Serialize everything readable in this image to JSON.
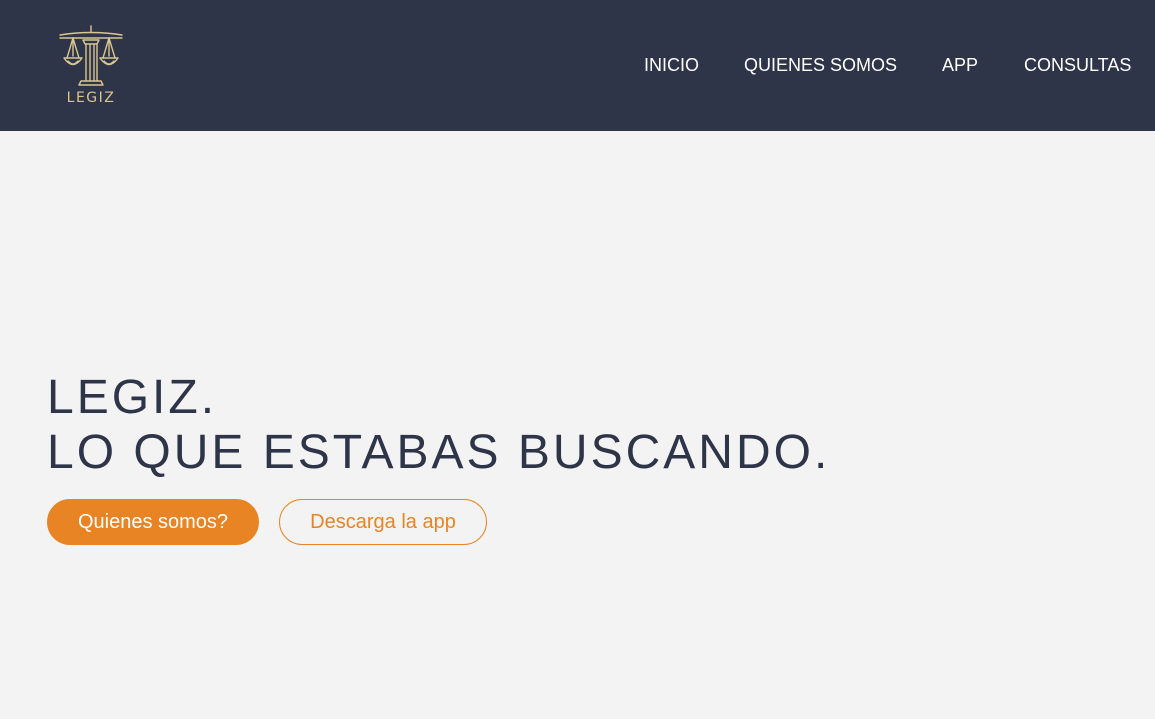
{
  "brand": {
    "logo_text": "LEGIZ",
    "logo_icon": "scales-of-justice-icon",
    "logo_color": "#d9c58f"
  },
  "nav": {
    "items": [
      {
        "label": "INICIO"
      },
      {
        "label": "QUIENES SOMOS"
      },
      {
        "label": "APP"
      },
      {
        "label": "CONSULTAS"
      }
    ]
  },
  "hero": {
    "title_line1": "LEGIZ.",
    "title_line2": "LO QUE ESTABAS BUSCANDO.",
    "primary_button": "Quienes somos?",
    "secondary_button": "Descarga la app"
  },
  "colors": {
    "header_bg": "#2e3548",
    "page_bg": "#f3f3f3",
    "accent": "#e88424",
    "title_text": "#2e3548"
  }
}
